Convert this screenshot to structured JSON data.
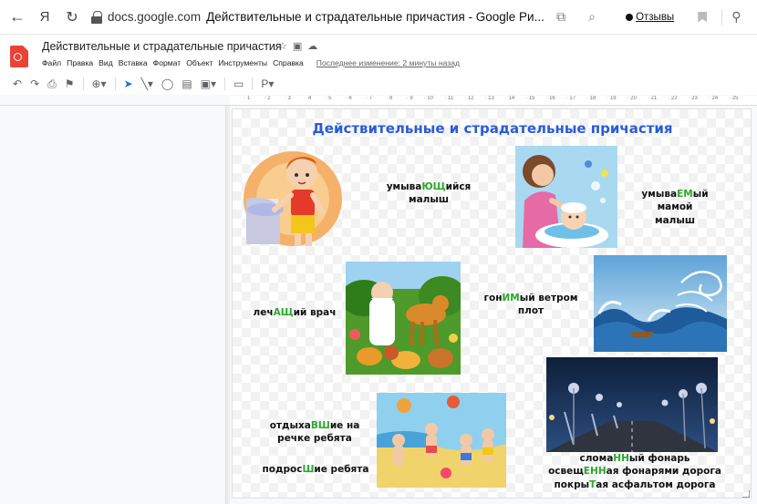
{
  "browser": {
    "back_icon": "arrow-left-icon",
    "yandex_icon": "Я",
    "reload_icon": "reload-icon",
    "domain": "docs.google.com",
    "page_title": "Действительные и страдательные причастия - Google Ри...",
    "reviews_label": "Отзывы"
  },
  "doc": {
    "title": "Действительные и страдательные причастия",
    "menu": [
      "Файл",
      "Правка",
      "Вид",
      "Вставка",
      "Формат",
      "Объект",
      "Инструменты",
      "Справка"
    ],
    "last_edit": "Последнее изменение: 2 минуты назад"
  },
  "ruler_ticks": [
    "1",
    "2",
    "3",
    "4",
    "5",
    "6",
    "7",
    "8",
    "9",
    "10",
    "11",
    "12",
    "13",
    "14",
    "15",
    "16",
    "17",
    "18",
    "19",
    "20",
    "21",
    "22",
    "23",
    "24",
    "25"
  ],
  "slide": {
    "title": "Действительные и страдательные причастия",
    "captions": {
      "c1": {
        "pre": "умыва",
        "hl": "ЮЩ",
        "post": "ийся",
        "line2": "малыш"
      },
      "c2": {
        "pre": "умыва",
        "hl": "ЕМ",
        "post": "ый мамой",
        "line2": "малыш"
      },
      "c3": {
        "pre": "леч",
        "hl": "АЩ",
        "post": "ий врач"
      },
      "c4": {
        "pre": "гон",
        "hl": "ИМ",
        "post": "ый ветром",
        "line2": "плот"
      },
      "c5": {
        "pre": "отдыха",
        "hl": "ВШ",
        "post": "ие на",
        "line2": "речке ребята"
      },
      "c6": {
        "pre": "подрос",
        "hl": "Ш",
        "post": "ие ребята"
      },
      "c7": {
        "l1_pre": "слома",
        "l1_hl": "НН",
        "l1_post": "ый фонарь",
        "l2_pre": "освещ",
        "l2_hl": "ЕНН",
        "l2_post": "ая фонарями дорога",
        "l3_pre": "покры",
        "l3_hl": "Т",
        "l3_post": "ая асфальтом дорога"
      }
    }
  },
  "colors": {
    "title_blue": "#2a5bd7",
    "suffix_green": "#2da82d",
    "docs_red": "#e84336"
  }
}
